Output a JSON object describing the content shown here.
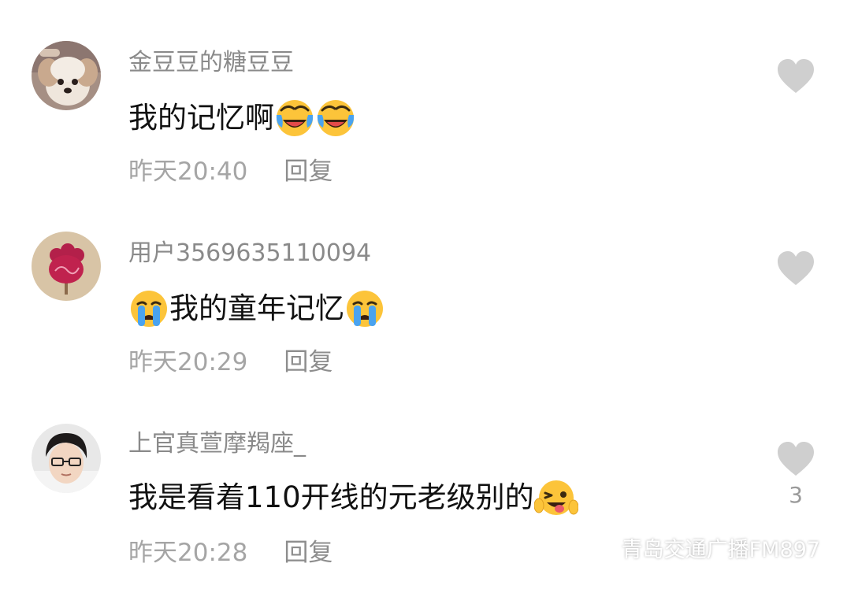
{
  "comments": [
    {
      "username": "金豆豆的糖豆豆",
      "text_before": "",
      "text": "我的记忆啊",
      "emojis_after": [
        "laughing-cry-emoji",
        "laughing-cry-emoji"
      ],
      "time": "昨天20:40",
      "reply_label": "回复",
      "like_count": "",
      "avatar": "puppy-avatar"
    },
    {
      "username": "用户3569635110094",
      "text_before": "crying-emoji",
      "text": "我的童年记忆",
      "emojis_after": [
        "crying-emoji"
      ],
      "time": "昨天20:29",
      "reply_label": "回复",
      "like_count": "",
      "avatar": "flower-avatar"
    },
    {
      "username": "上官真萱摩羯座_",
      "text_before": "",
      "text": "我是看着110开线的元老级别的",
      "emojis_after": [
        "winking-tongue-emoji"
      ],
      "time": "昨天20:28",
      "reply_label": "回复",
      "like_count": "3",
      "avatar": "person-glasses-avatar"
    }
  ],
  "watermark": {
    "text": "青岛交通广播FM897",
    "icon": "wechat-icon"
  },
  "colors": {
    "username": "#8a8a8a",
    "content": "#111111",
    "meta": "#a5a5a5",
    "heart": "#cfcfcf"
  }
}
